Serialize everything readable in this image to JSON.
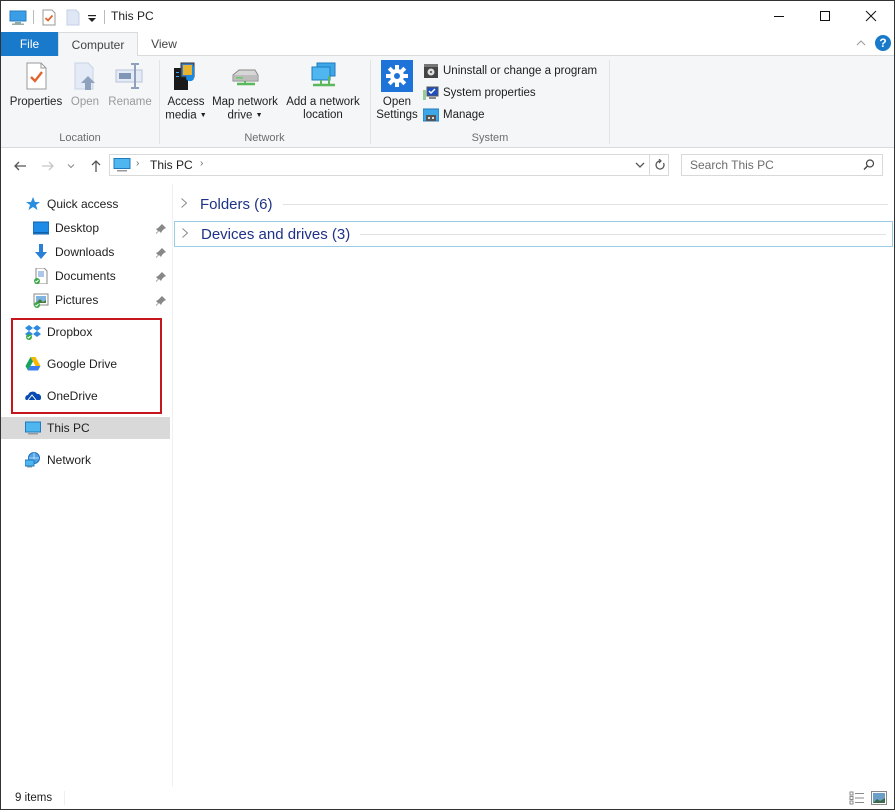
{
  "window": {
    "title": "This PC",
    "controls": {
      "minimize": "minimize",
      "maximize": "maximize",
      "close": "close"
    }
  },
  "quick_access_toolbar": {
    "icons": [
      "computer-icon",
      "properties-icon",
      "new-folder-icon",
      "customize-dropdown-icon"
    ]
  },
  "ribbon": {
    "tabs": [
      {
        "label": "File",
        "active": false
      },
      {
        "label": "Computer",
        "active": true
      },
      {
        "label": "View",
        "active": false
      }
    ],
    "help_label": "?",
    "groups": {
      "location": {
        "label": "Location",
        "buttons": [
          {
            "label": "Properties",
            "enabled": true
          },
          {
            "label": "Open",
            "enabled": false
          },
          {
            "label": "Rename",
            "enabled": false
          }
        ]
      },
      "network": {
        "label": "Network",
        "buttons": [
          {
            "line1": "Access",
            "line2": "media",
            "has_dropdown": true
          },
          {
            "line1": "Map network",
            "line2": "drive",
            "has_dropdown": true
          },
          {
            "line1": "Add a network",
            "line2": "location",
            "has_dropdown": false
          }
        ]
      },
      "system": {
        "label": "System",
        "open_settings": {
          "line1": "Open",
          "line2": "Settings"
        },
        "small_buttons": [
          {
            "label": "Uninstall or change a program"
          },
          {
            "label": "System properties"
          },
          {
            "label": "Manage"
          }
        ]
      }
    },
    "accent_color": "#1979ca"
  },
  "address_bar": {
    "breadcrumb": [
      "This PC"
    ],
    "search_placeholder": "Search This PC"
  },
  "nav_pane": {
    "quick_access": {
      "label": "Quick access",
      "items": [
        {
          "label": "Desktop",
          "pinned": true
        },
        {
          "label": "Downloads",
          "pinned": true
        },
        {
          "label": "Documents",
          "pinned": true
        },
        {
          "label": "Pictures",
          "pinned": true
        }
      ]
    },
    "cloud_items": [
      {
        "label": "Dropbox"
      },
      {
        "label": "Google Drive"
      },
      {
        "label": "OneDrive"
      }
    ],
    "this_pc": {
      "label": "This PC",
      "selected": true
    },
    "network": {
      "label": "Network"
    },
    "highlight_color": "#c4161c"
  },
  "content": {
    "groups": [
      {
        "label": "Folders (6)",
        "collapsed": true,
        "focused": false
      },
      {
        "label": "Devices and drives (3)",
        "collapsed": true,
        "focused": true
      }
    ]
  },
  "status_bar": {
    "item_count": "9 items",
    "views": [
      "details-view",
      "large-icons-view"
    ]
  }
}
